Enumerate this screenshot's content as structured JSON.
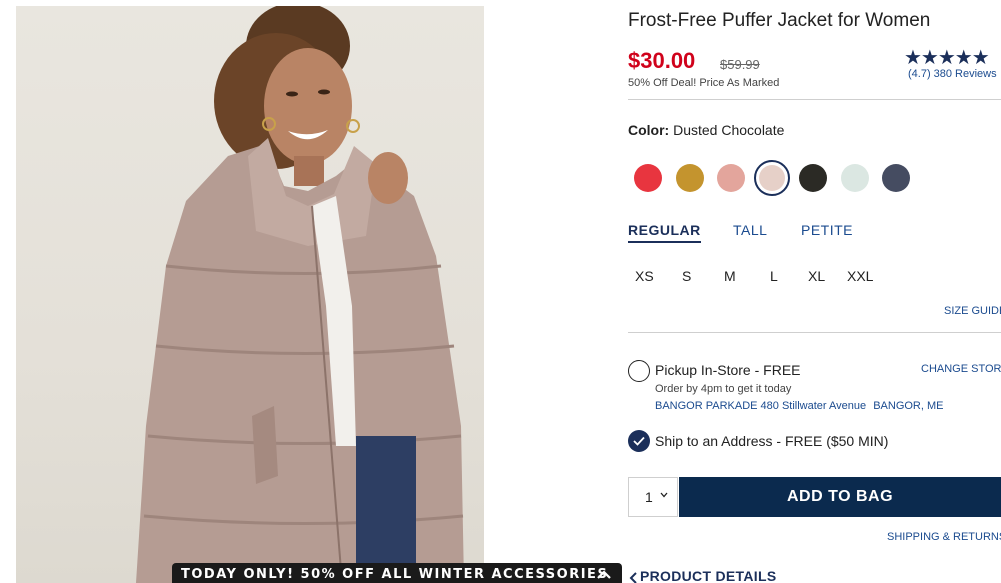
{
  "product": {
    "title": "Frost-Free Puffer Jacket for Women",
    "price": "$30.00",
    "original_price": "$59.99",
    "deal_text": "50% Off Deal! Price As Marked",
    "stars_display": "★★★★★",
    "rating": 4.7,
    "rating_text": "(4.7)",
    "reviews_text": "380 Reviews"
  },
  "color": {
    "label": "Color:",
    "selected_name": "Dusted Chocolate",
    "swatches": [
      "#e8353f",
      "#c4942e",
      "#e3a59c",
      "#e6d0c8",
      "#2b2a25",
      "#dbe7e2",
      "#454c61"
    ]
  },
  "fit": {
    "tabs": [
      "REGULAR",
      "TALL",
      "PETITE"
    ],
    "active": "REGULAR"
  },
  "sizes": [
    "XS",
    "S",
    "M",
    "L",
    "XL",
    "XXL"
  ],
  "size_guide_label": "SIZE GUIDE",
  "fulfillment": {
    "pickup_label": "Pickup In-Store - FREE",
    "change_store_label": "CHANGE STORE",
    "order_by_text": "Order by 4pm to get it today",
    "store_address": "BANGOR PARKADE 480 Stillwater Avenue",
    "store_city": "BANGOR, ME",
    "ship_label": "Ship to an Address - FREE ($50 MIN)"
  },
  "cart": {
    "quantity": "1",
    "add_to_bag_label": "ADD TO BAG"
  },
  "shipping_returns_label": "SHIPPING & RETURNS",
  "product_details_label": "PRODUCT DETAILS",
  "promo_banner": "TODAY ONLY! 50% OFF ALL WINTER ACCESSORIES",
  "colors": {
    "sale_red": "#d0021b",
    "navy": "#0b2a4e",
    "link_blue": "#1b4b8f"
  }
}
